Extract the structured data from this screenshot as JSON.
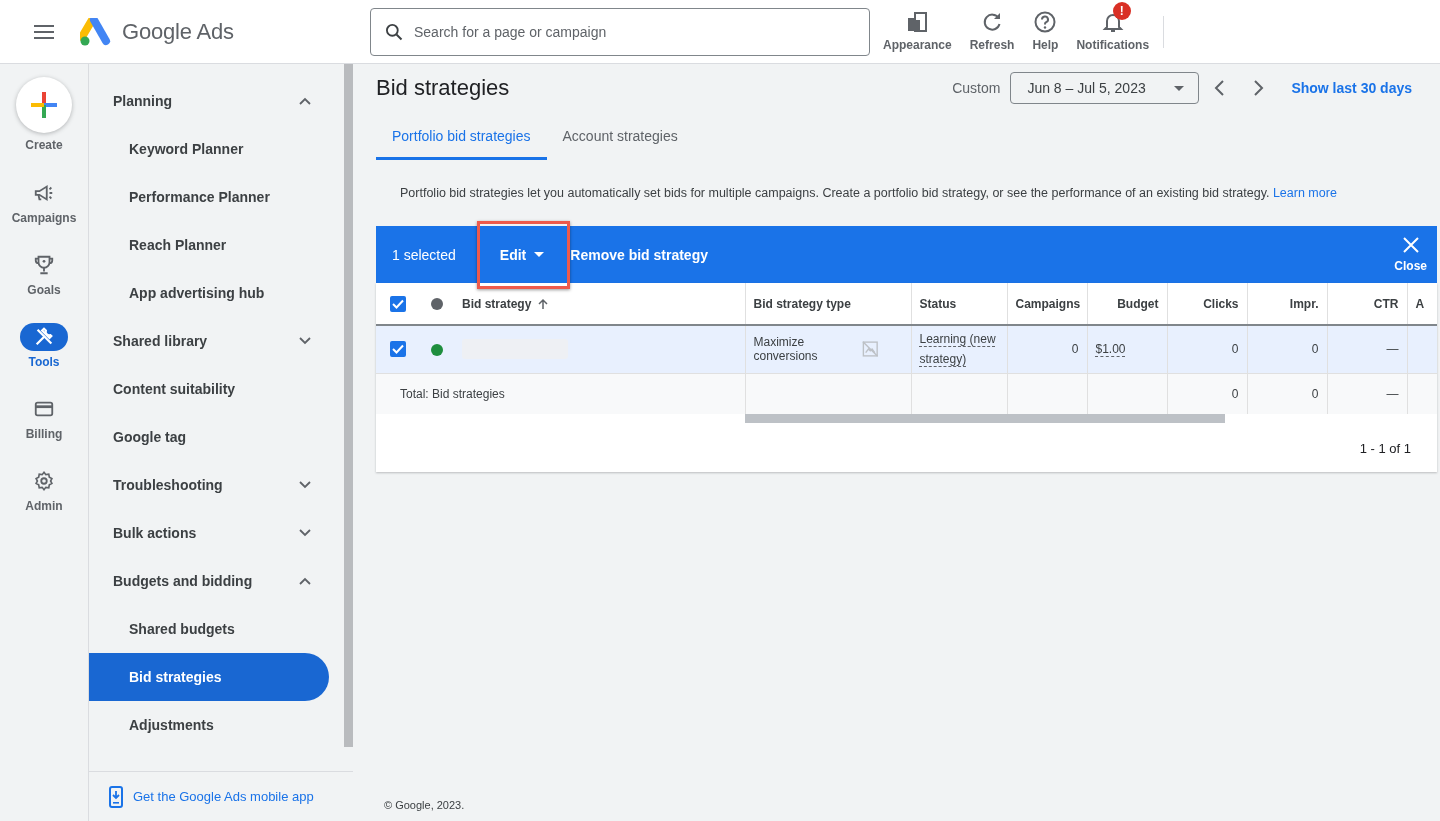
{
  "header": {
    "app_name": "Google Ads",
    "search": {
      "placeholder": "Search for a page or campaign"
    },
    "actions": [
      {
        "label": "Appearance",
        "kind": "appearance"
      },
      {
        "label": "Refresh",
        "kind": "refresh"
      },
      {
        "label": "Help",
        "kind": "help"
      },
      {
        "label": "Notifications",
        "kind": "notifications",
        "badge": "!"
      }
    ]
  },
  "rail": [
    {
      "label": "Create",
      "kind": "create",
      "selected": false
    },
    {
      "label": "Campaigns",
      "kind": "campaigns",
      "selected": false
    },
    {
      "label": "Goals",
      "kind": "goals",
      "selected": false
    },
    {
      "label": "Tools",
      "kind": "tools",
      "selected": true
    },
    {
      "label": "Billing",
      "kind": "billing",
      "selected": false
    },
    {
      "label": "Admin",
      "kind": "admin",
      "selected": false
    }
  ],
  "nav": {
    "items": [
      {
        "label": "Planning",
        "kind": "group",
        "expanded": true,
        "children": [
          {
            "label": "Keyword Planner",
            "kind": "link",
            "selected": false
          },
          {
            "label": "Performance Planner",
            "kind": "link",
            "selected": false
          },
          {
            "label": "Reach Planner",
            "kind": "link",
            "selected": false
          },
          {
            "label": "App advertising hub",
            "kind": "link",
            "selected": false
          }
        ]
      },
      {
        "label": "Shared library",
        "kind": "group",
        "expanded": false
      },
      {
        "label": "Content suitability",
        "kind": "link",
        "selected": false
      },
      {
        "label": "Google tag",
        "kind": "link",
        "selected": false
      },
      {
        "label": "Troubleshooting",
        "kind": "group",
        "expanded": false
      },
      {
        "label": "Bulk actions",
        "kind": "group",
        "expanded": false
      },
      {
        "label": "Budgets and bidding",
        "kind": "group",
        "expanded": true,
        "children": [
          {
            "label": "Shared budgets",
            "kind": "link",
            "selected": false
          },
          {
            "label": "Bid strategies",
            "kind": "link",
            "selected": true
          },
          {
            "label": "Adjustments",
            "kind": "link",
            "selected": false
          }
        ]
      }
    ],
    "footer_link": "Get the Google Ads mobile app"
  },
  "page": {
    "title": "Bid strategies",
    "date_label": "Custom",
    "date_range": "Jun 8 – Jul 5, 2023",
    "show_last": "Show last 30 days",
    "tabs": [
      {
        "label": "Portfolio bid strategies",
        "selected": true
      },
      {
        "label": "Account strategies",
        "selected": false
      }
    ],
    "description": "Portfolio bid strategies let you automatically set bids for multiple campaigns. Create a portfolio bid strategy, or see the performance of an existing bid strategy.",
    "learn_more": "Learn more"
  },
  "selection_bar": {
    "count": "1 selected",
    "actions": [
      {
        "label": "Edit",
        "kind": "menu",
        "highlighted": true
      },
      {
        "label": "Remove bid strategy",
        "kind": "plain",
        "highlighted": false
      }
    ],
    "close": "Close"
  },
  "table": {
    "header_checked": true,
    "columns": [
      {
        "label": "Bid strategy",
        "kind": "text",
        "sorted": true
      },
      {
        "label": "Bid strategy type",
        "kind": "text",
        "sorted": false
      },
      {
        "label": "Status",
        "kind": "text",
        "sorted": false
      },
      {
        "label": "Campaigns",
        "kind": "number",
        "sorted": false
      },
      {
        "label": "Budget",
        "kind": "number",
        "sorted": false
      },
      {
        "label": "Clicks",
        "kind": "number",
        "sorted": false
      },
      {
        "label": "Impr.",
        "kind": "number",
        "sorted": false
      },
      {
        "label": "CTR",
        "kind": "number",
        "sorted": false
      },
      {
        "label": "A",
        "kind": "text",
        "sorted": false
      }
    ],
    "rows": [
      {
        "checked": true,
        "selected": true,
        "color": "#1e8e3e",
        "cells": [
          {
            "text": "",
            "kind": "hidden"
          },
          {
            "text": "Maximize conversions",
            "kind": "type"
          },
          {
            "text": "Learning (new strategy)",
            "kind": "tip"
          },
          {
            "text": "0",
            "kind": "number"
          },
          {
            "text": "$1.00",
            "kind": "tip"
          },
          {
            "text": "0",
            "kind": "number"
          },
          {
            "text": "0",
            "kind": "number"
          },
          {
            "text": "—",
            "kind": "number"
          }
        ]
      }
    ],
    "total": {
      "cells": [
        {
          "text": "Total: Bid strategies",
          "kind": "label"
        },
        {
          "text": "",
          "kind": "text"
        },
        {
          "text": "",
          "kind": "text"
        },
        {
          "text": "",
          "kind": "number"
        },
        {
          "text": "",
          "kind": "number"
        },
        {
          "text": "0",
          "kind": "number"
        },
        {
          "text": "0",
          "kind": "number"
        },
        {
          "text": "—",
          "kind": "number"
        }
      ]
    },
    "pagination": "1 - 1 of 1"
  },
  "footer": "© Google, 2023."
}
